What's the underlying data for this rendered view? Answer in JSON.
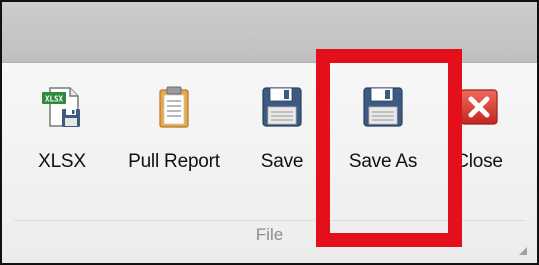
{
  "ribbon": {
    "group_label": "File",
    "buttons": [
      {
        "label": "XLSX",
        "icon": "xlsx-save-icon"
      },
      {
        "label": "Pull Report",
        "icon": "clipboard-icon"
      },
      {
        "label": "Save",
        "icon": "floppy-disk-icon"
      },
      {
        "label": "Save As",
        "icon": "floppy-disk-icon"
      },
      {
        "label": "Close",
        "icon": "close-x-icon"
      }
    ],
    "xlsx_badge_text": "XLSX"
  },
  "colors": {
    "highlight": "#e3101b",
    "close_red": "#d9382e",
    "xlsx_green": "#2e8b3e",
    "floppy_blue": "#3d5a80"
  },
  "annotation": {
    "highlighted_button": "Save As"
  }
}
